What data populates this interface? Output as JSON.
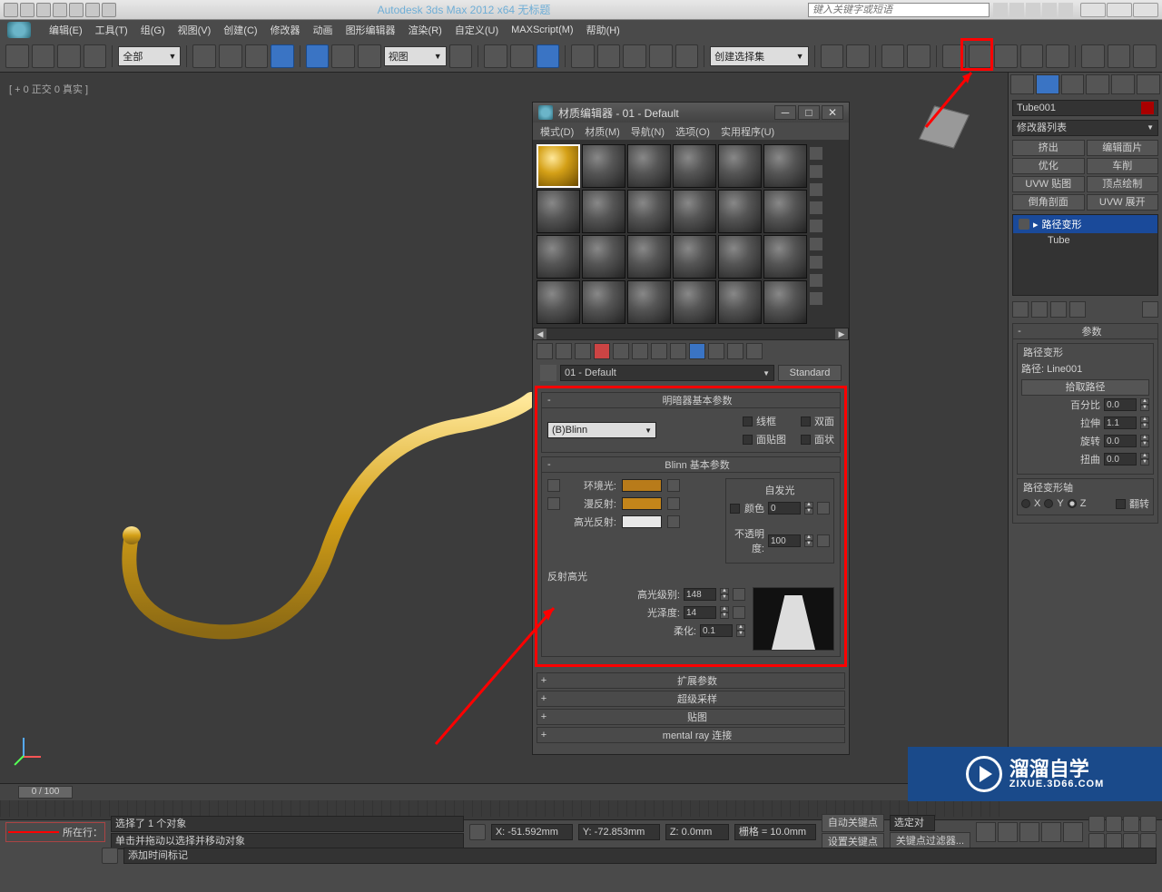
{
  "titlebar": {
    "title": "Autodesk 3ds Max 2012 x64    无标题",
    "search_placeholder": "键入关键字或短语"
  },
  "menubar": {
    "items": [
      "编辑(E)",
      "工具(T)",
      "组(G)",
      "视图(V)",
      "创建(C)",
      "修改器",
      "动画",
      "图形编辑器",
      "渲染(R)",
      "自定义(U)",
      "MAXScript(M)",
      "帮助(H)"
    ]
  },
  "toolbar": {
    "filter_combo": "全部",
    "view_combo": "视图",
    "named_sel": "创建选择集"
  },
  "viewport": {
    "label": "[ + 0 正交 0 真实 ]"
  },
  "mat_editor": {
    "title": "材质编辑器 - 01 - Default",
    "menu": [
      "模式(D)",
      "材质(M)",
      "导航(N)",
      "选项(O)",
      "实用程序(U)"
    ],
    "name": "01 - Default",
    "type_btn": "Standard",
    "shader_rollout": "明暗器基本参数",
    "shader": "(B)Blinn",
    "checks": {
      "wire": "线框",
      "two_sided": "双面",
      "face_map": "面贴图",
      "faceted": "面状"
    },
    "blinn_rollout": "Blinn 基本参数",
    "ambient": "环境光:",
    "diffuse": "漫反射:",
    "specular": "高光反射:",
    "self_illum": "自发光",
    "color_lbl": "颜色",
    "self_val": "0",
    "opacity_lbl": "不透明度:",
    "opacity_val": "100",
    "spec_hl": "反射高光",
    "spec_level": "高光级别:",
    "spec_level_val": "148",
    "gloss": "光泽度:",
    "gloss_val": "14",
    "soften": "柔化:",
    "soften_val": "0.1",
    "collapsed": [
      "扩展参数",
      "超级采样",
      "贴图",
      "mental ray 连接"
    ]
  },
  "cmd_panel": {
    "obj_name": "Tube001",
    "mod_list": "修改器列表",
    "mod_btns": [
      "挤出",
      "编辑面片",
      "优化",
      "车削",
      "UVW 贴图",
      "顶点绘制",
      "倒角剖面",
      "UVW 展开"
    ],
    "stack": [
      {
        "name": "路径变形",
        "sel": true
      },
      {
        "name": "Tube",
        "sel": false
      }
    ],
    "params_title": "参数",
    "path_deform": "路径变形",
    "path_line": "路径: Line001",
    "pick_path": "拾取路径",
    "percent": "百分比",
    "percent_val": "0.0",
    "stretch": "拉伸",
    "stretch_val": "1.1",
    "rotation": "旋转",
    "rotation_val": "0.0",
    "twist": "扭曲",
    "twist_val": "0.0",
    "axis_title": "路径变形轴",
    "axes": [
      "X",
      "Y",
      "Z"
    ],
    "flip": "翻转"
  },
  "timeline": {
    "slider": "0 / 100"
  },
  "status": {
    "sel_info": "选择了 1 个对象",
    "prompt": "单击并拖动以选择并移动对象",
    "x": "X: -51.592mm",
    "y": "Y: -72.853mm",
    "z": "Z: 0.0mm",
    "grid": "栅格 = 10.0mm",
    "auto_key": "自动关键点",
    "selected": "选定对",
    "set_key": "设置关键点",
    "key_filters": "关键点过滤器...",
    "add_time": "添加时间标记",
    "row_label": "所在行："
  },
  "watermark": {
    "text": "溜溜自学",
    "sub": "ZIXUE.3D66.COM"
  }
}
